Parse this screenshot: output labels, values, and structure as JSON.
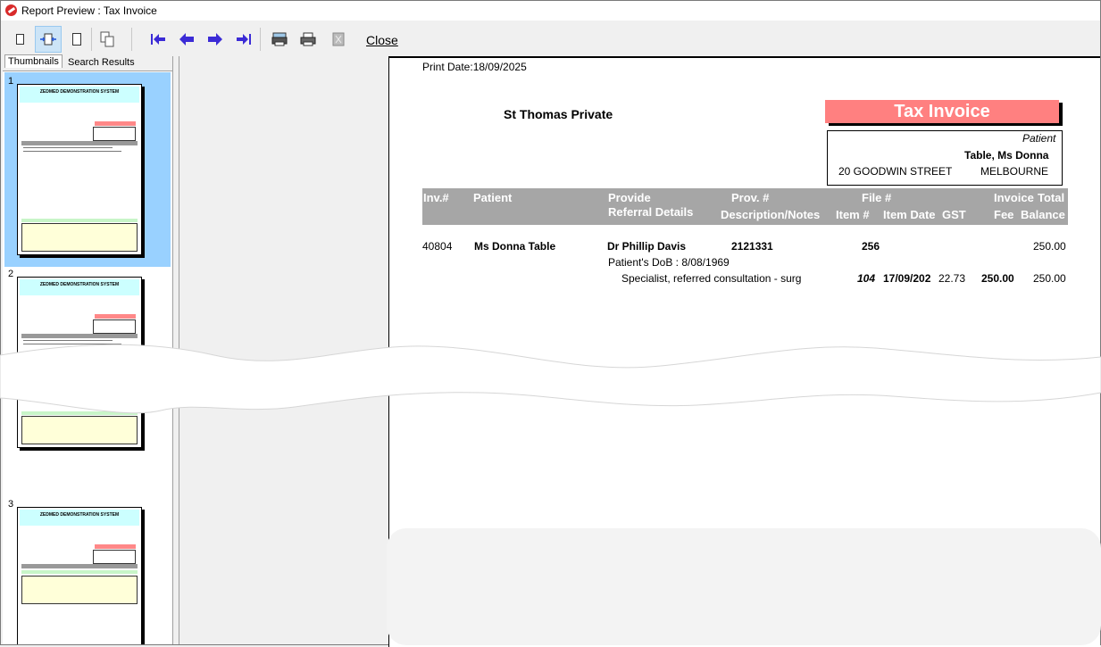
{
  "window": {
    "title": "Report Preview : Tax Invoice"
  },
  "toolbar": {
    "close_label": "Close"
  },
  "tabs": {
    "thumbnails": "Thumbnails",
    "search": "Search Results"
  },
  "thumbnails": [
    {
      "number": "1",
      "heading": "ZEDMED DEMONSTRATION SYSTEM",
      "selected": true
    },
    {
      "number": "2",
      "heading": "ZEDMED DEMONSTRATION SYSTEM",
      "selected": false
    },
    {
      "number": "3",
      "heading": "ZEDMED DEMONSTRATION SYSTEM",
      "selected": false
    }
  ],
  "report": {
    "print_date": "Print Date:18/09/2025",
    "practice": "St Thomas Private",
    "banner": "Tax Invoice",
    "patient_label": "Patient",
    "patient_name": "Table, Ms Donna",
    "street": "20 GOODWIN STREET",
    "city": "MELBOURNE",
    "headers": {
      "inv": "Inv.#",
      "patient": "Patient",
      "provide": "Provide",
      "referral": "Referral Details",
      "prov_no": "Prov. #",
      "desc": "Description/Notes",
      "file_no": "File #",
      "item_no": "Item #",
      "item_date": "Item Date",
      "gst": "GST",
      "invoice": "Invoice",
      "fee": "Fee",
      "total": "Total",
      "balance": "Balance"
    },
    "row": {
      "inv": "40804",
      "patient": "Ms Donna Table",
      "provider": "Dr Phillip Davis",
      "prov_no": "2121331",
      "file_no": "256",
      "total": "250.00",
      "dob": "Patient's DoB : 8/08/1969",
      "description": "Specialist, referred consultation - surg",
      "item_no": "104",
      "item_date": "17/09/202",
      "gst": "22.73",
      "fee": "250.00",
      "balance": "250.00"
    }
  },
  "colors": {
    "banner": "#ff8080",
    "header_bar": "#a6a6a6",
    "selected_thumb": "#99d1ff",
    "arrows": "#3b2bd6"
  }
}
